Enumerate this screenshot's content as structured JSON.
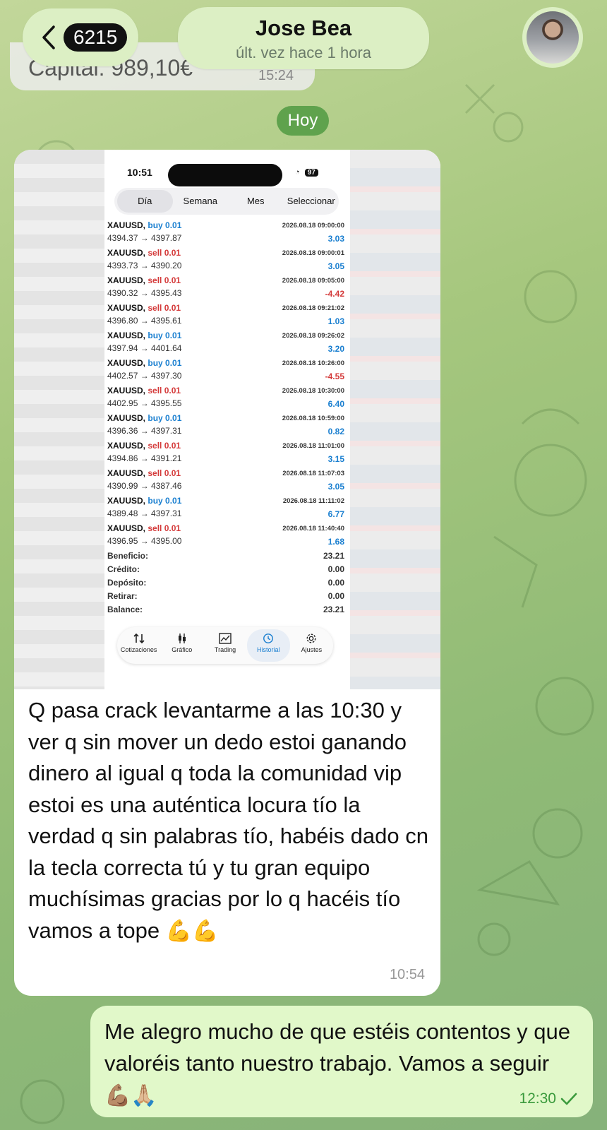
{
  "header": {
    "unread_count": "6215",
    "contact_name": "Jose Bea",
    "status": "últ. vez hace 1 hora"
  },
  "previous_message": {
    "text": "Capital: 989,10€",
    "time": "15:24"
  },
  "date_separator": "Hoy",
  "incoming": {
    "screenshot": {
      "status_time": "10:51",
      "battery": "97",
      "segments": [
        "Día",
        "Semana",
        "Mes",
        "Seleccionar"
      ],
      "active_segment": "Día",
      "trades": [
        {
          "symbol": "XAUUSD,",
          "side": "buy 0.01",
          "prices": "4394.37 → 4397.87",
          "date": "2026.08.18 09:00:00",
          "profit": "3.03"
        },
        {
          "symbol": "XAUUSD,",
          "side": "sell 0.01",
          "prices": "4393.73 → 4390.20",
          "date": "2026.08.18 09:00:01",
          "profit": "3.05"
        },
        {
          "symbol": "XAUUSD,",
          "side": "sell 0.01",
          "prices": "4390.32 → 4395.43",
          "date": "2026.08.18 09:05:00",
          "profit": "-4.42"
        },
        {
          "symbol": "XAUUSD,",
          "side": "sell 0.01",
          "prices": "4396.80 → 4395.61",
          "date": "2026.08.18 09:21:02",
          "profit": "1.03"
        },
        {
          "symbol": "XAUUSD,",
          "side": "buy 0.01",
          "prices": "4397.94 → 4401.64",
          "date": "2026.08.18 09:26:02",
          "profit": "3.20"
        },
        {
          "symbol": "XAUUSD,",
          "side": "buy 0.01",
          "prices": "4402.57 → 4397.30",
          "date": "2026.08.18 10:26:00",
          "profit": "-4.55"
        },
        {
          "symbol": "XAUUSD,",
          "side": "sell 0.01",
          "prices": "4402.95 → 4395.55",
          "date": "2026.08.18 10:30:00",
          "profit": "6.40"
        },
        {
          "symbol": "XAUUSD,",
          "side": "buy 0.01",
          "prices": "4396.36 → 4397.31",
          "date": "2026.08.18 10:59:00",
          "profit": "0.82"
        },
        {
          "symbol": "XAUUSD,",
          "side": "sell 0.01",
          "prices": "4394.86 → 4391.21",
          "date": "2026.08.18 11:01:00",
          "profit": "3.15"
        },
        {
          "symbol": "XAUUSD,",
          "side": "sell 0.01",
          "prices": "4390.99 → 4387.46",
          "date": "2026.08.18 11:07:03",
          "profit": "3.05"
        },
        {
          "symbol": "XAUUSD,",
          "side": "buy 0.01",
          "prices": "4389.48 → 4397.31",
          "date": "2026.08.18 11:11:02",
          "profit": "6.77"
        },
        {
          "symbol": "XAUUSD,",
          "side": "sell 0.01",
          "prices": "4396.95 → 4395.00",
          "date": "2026.08.18 11:40:40",
          "profit": "1.68"
        }
      ],
      "summary": [
        {
          "label": "Beneficio:",
          "value": "23.21"
        },
        {
          "label": "Crédito:",
          "value": "0.00"
        },
        {
          "label": "Depósito:",
          "value": "0.00"
        },
        {
          "label": "Retirar:",
          "value": "0.00"
        },
        {
          "label": "Balance:",
          "value": "23.21"
        }
      ],
      "tabs": [
        {
          "label": "Cotizaciones",
          "icon": "arrows-icon"
        },
        {
          "label": "Gráfico",
          "icon": "candles-icon"
        },
        {
          "label": "Trading",
          "icon": "trend-icon"
        },
        {
          "label": "Historial",
          "icon": "clock-icon"
        },
        {
          "label": "Ajustes",
          "icon": "gear-icon"
        }
      ],
      "active_tab": "Historial"
    },
    "text": "Q pasa crack levantarme a las 10:30 y ver q sin mover un dedo estoi ganando dinero al igual q toda la comunidad vip estoi es una auténtica locura tío la verdad q sin palabras tío, habéis dado cn la tecla correcta tú y tu gran equipo muchísimas gracias por lo q hacéis tío vamos a tope",
    "emoji": "💪💪",
    "time": "10:54"
  },
  "outgoing": {
    "text": "Me alegro mucho de que estéis contentos y que valoréis tanto nuestro trabajo. Vamos a seguir",
    "emoji": "💪🏽🙏🏼",
    "time": "12:30"
  },
  "colors": {
    "outgoing_bubble": "#e1f8c9",
    "date_chip": "#5fa24d",
    "buy": "#1a7fd0",
    "sell": "#d43a3a"
  }
}
